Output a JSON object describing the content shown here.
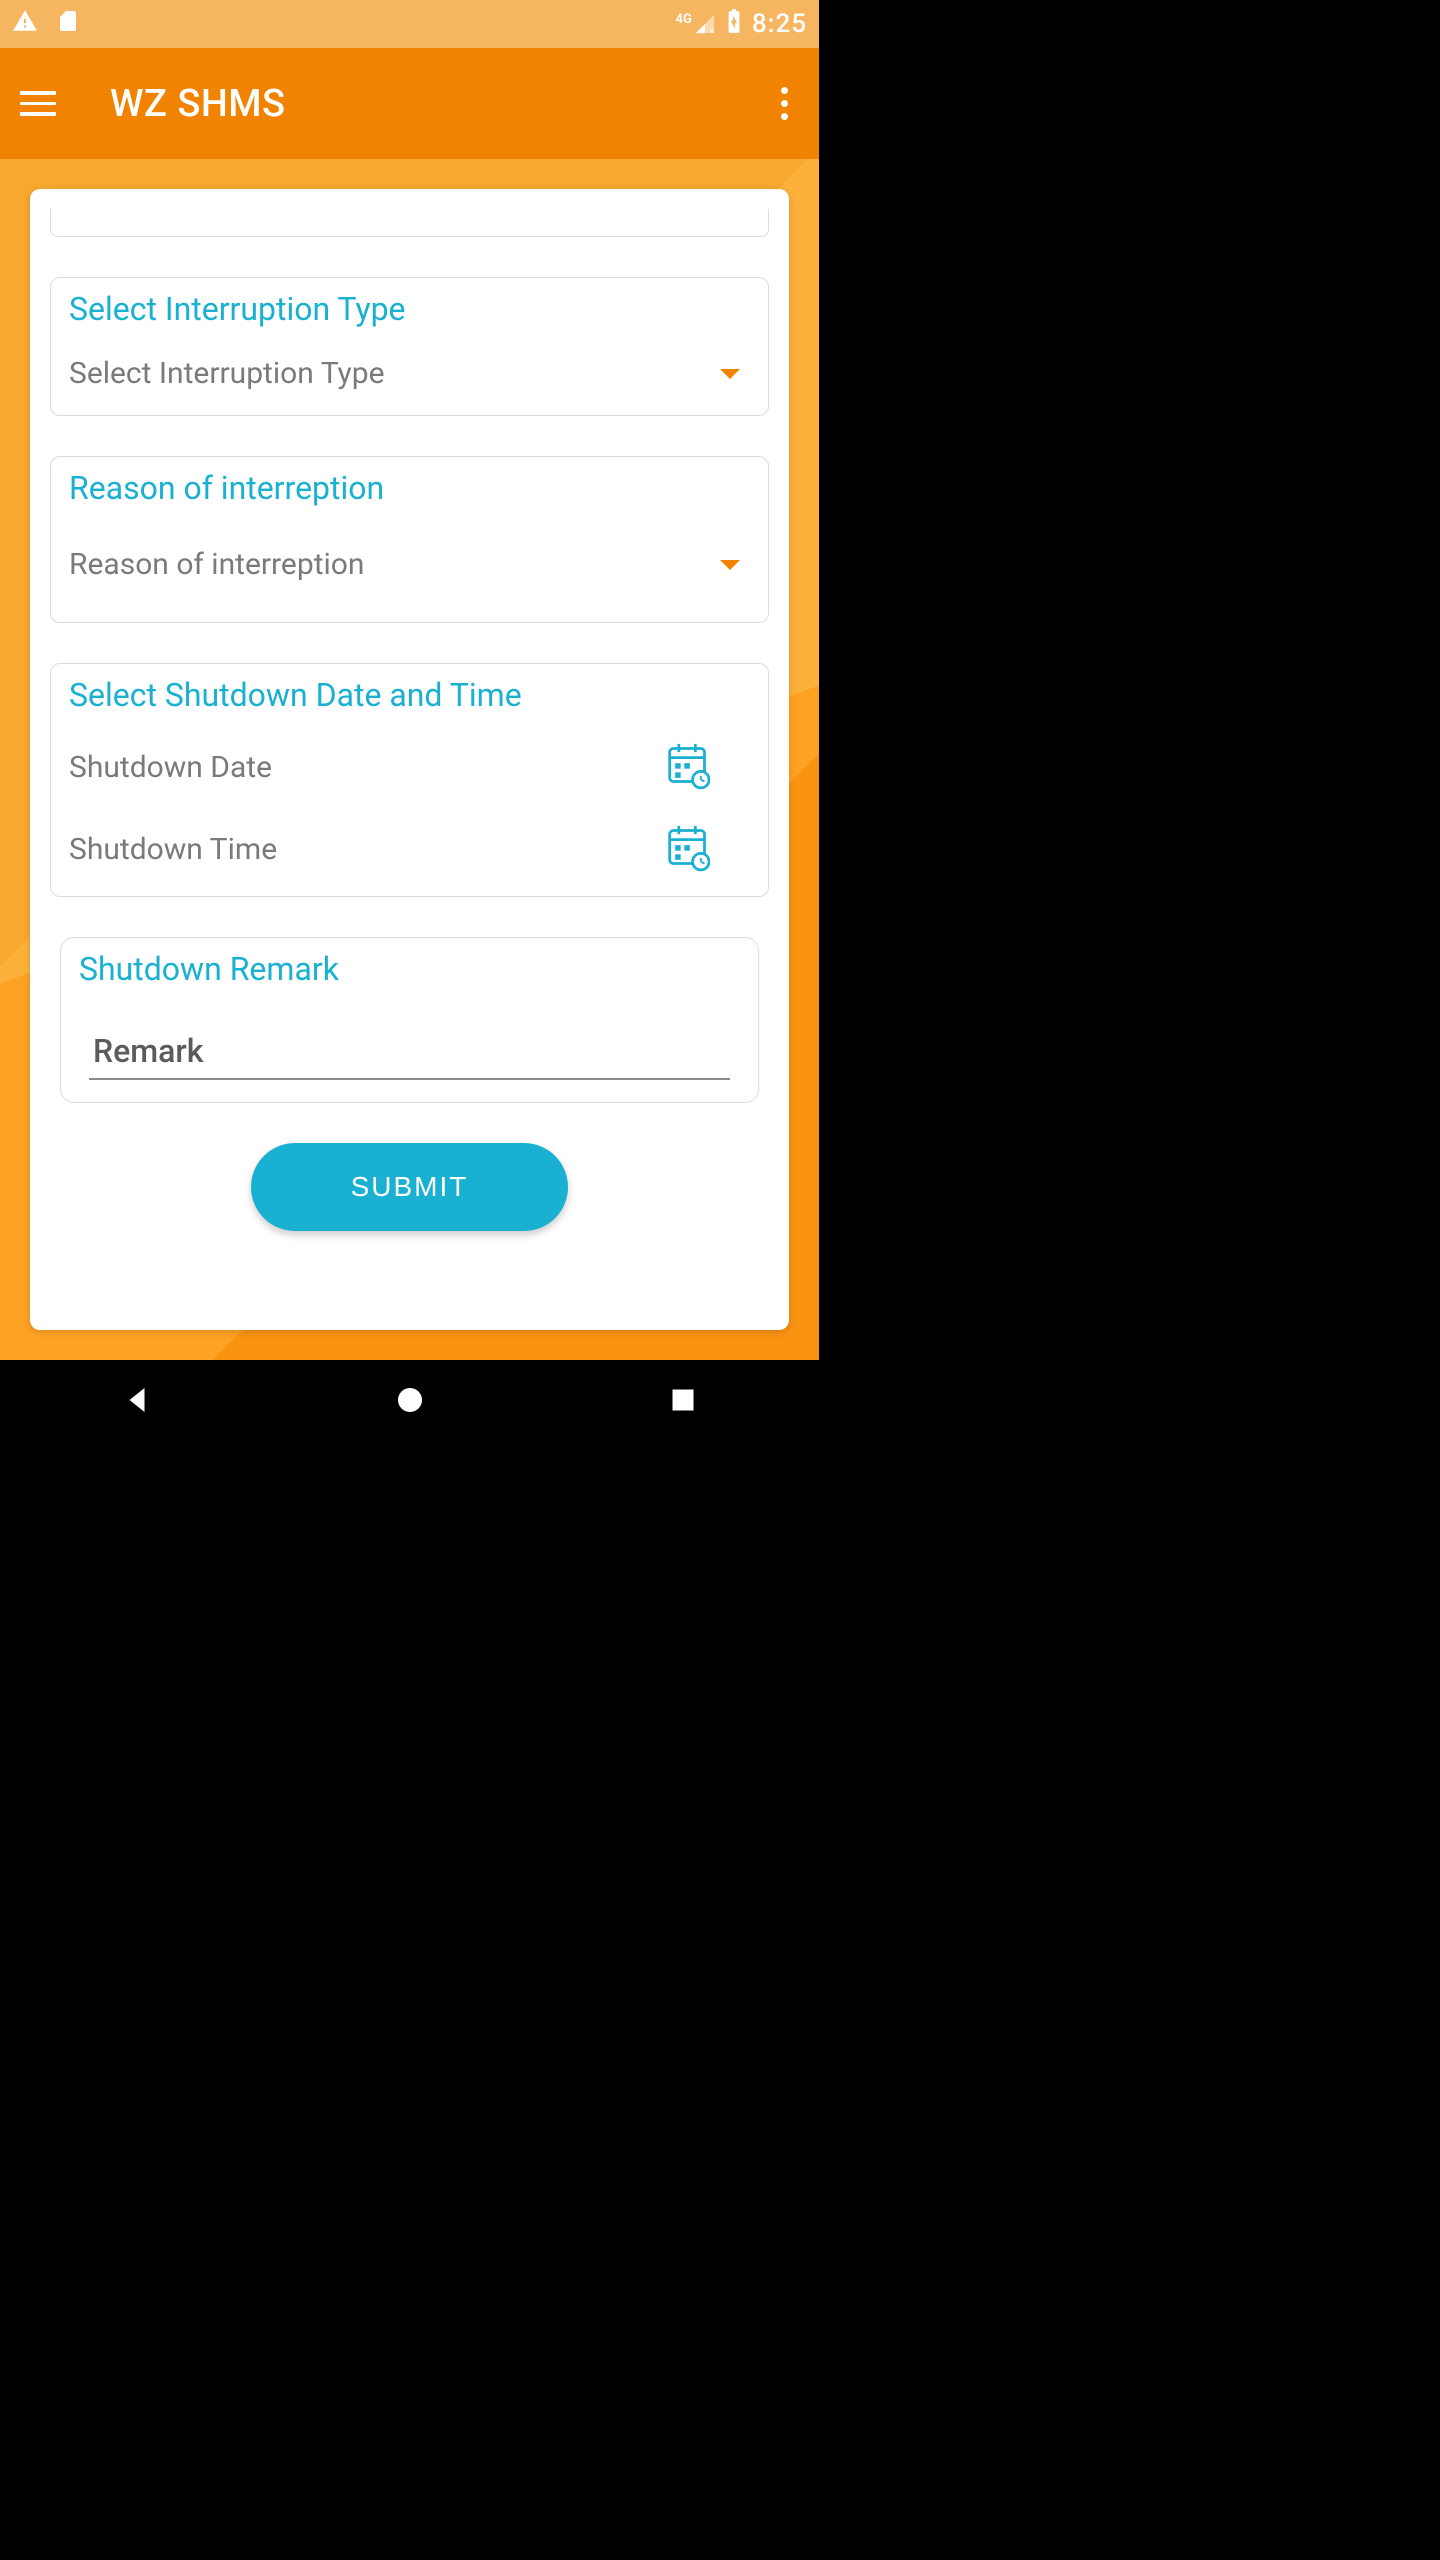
{
  "status": {
    "network_label": "4G",
    "time": "8:25"
  },
  "header": {
    "title": "WZ SHMS"
  },
  "form": {
    "interruption_type": {
      "label": "Select Interruption Type",
      "value_text": "Select Interruption Type"
    },
    "reason": {
      "label": "Reason of interreption",
      "value_text": "Reason of interreption"
    },
    "datetime": {
      "label": "Select Shutdown Date and Time",
      "date_placeholder": "Shutdown Date",
      "time_placeholder": "Shutdown Time"
    },
    "remark": {
      "label": "Shutdown Remark",
      "placeholder": "Remark"
    },
    "submit_label": "SUBMIT"
  },
  "colors": {
    "accent_teal": "#19b0d1",
    "brand_orange": "#f28300",
    "status_bg": "#f6b560"
  }
}
